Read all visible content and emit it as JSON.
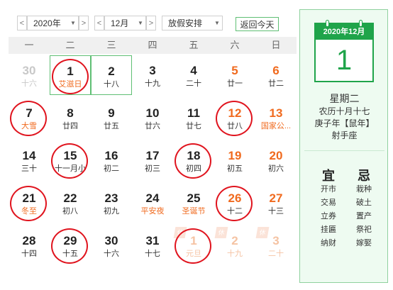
{
  "toolbar": {
    "prev_label": "<",
    "next_label": ">",
    "year_value": "2020年",
    "month_value": "12月",
    "holiday_select": "放假安排",
    "today_button": "返回今天"
  },
  "weekdays": [
    "一",
    "二",
    "三",
    "四",
    "五",
    "六",
    "日"
  ],
  "weeks": [
    [
      {
        "num": "30",
        "sub": "十六",
        "state": "other"
      },
      {
        "num": "1",
        "sub": "艾滋日",
        "state": "fest",
        "today": true,
        "circled": true
      },
      {
        "num": "2",
        "sub": "十八",
        "selected": true
      },
      {
        "num": "3",
        "sub": "十九"
      },
      {
        "num": "4",
        "sub": "二十"
      },
      {
        "num": "5",
        "sub": "廿一",
        "state": "weekend"
      },
      {
        "num": "6",
        "sub": "廿二",
        "state": "weekend"
      }
    ],
    [
      {
        "num": "7",
        "sub": "大雪",
        "state": "fest",
        "circled": true
      },
      {
        "num": "8",
        "sub": "廿四"
      },
      {
        "num": "9",
        "sub": "廿五"
      },
      {
        "num": "10",
        "sub": "廿六"
      },
      {
        "num": "11",
        "sub": "廿七"
      },
      {
        "num": "12",
        "sub": "廿八",
        "state": "weekend",
        "circled": true
      },
      {
        "num": "13",
        "sub": "国家公...",
        "state": "weekend-fest"
      }
    ],
    [
      {
        "num": "14",
        "sub": "三十"
      },
      {
        "num": "15",
        "sub": "十一月小",
        "circled": true
      },
      {
        "num": "16",
        "sub": "初二"
      },
      {
        "num": "17",
        "sub": "初三"
      },
      {
        "num": "18",
        "sub": "初四",
        "circled": true
      },
      {
        "num": "19",
        "sub": "初五",
        "state": "weekend"
      },
      {
        "num": "20",
        "sub": "初六",
        "state": "weekend"
      }
    ],
    [
      {
        "num": "21",
        "sub": "冬至",
        "state": "fest",
        "circled": true
      },
      {
        "num": "22",
        "sub": "初八"
      },
      {
        "num": "23",
        "sub": "初九"
      },
      {
        "num": "24",
        "sub": "平安夜",
        "state": "fest"
      },
      {
        "num": "25",
        "sub": "圣诞节",
        "state": "fest"
      },
      {
        "num": "26",
        "sub": "十二",
        "state": "weekend",
        "circled": true
      },
      {
        "num": "27",
        "sub": "十三",
        "state": "weekend"
      }
    ],
    [
      {
        "num": "28",
        "sub": "十四"
      },
      {
        "num": "29",
        "sub": "十五",
        "circled": true
      },
      {
        "num": "30",
        "sub": "十六"
      },
      {
        "num": "31",
        "sub": "十七"
      },
      {
        "num": "1",
        "sub": "元旦",
        "state": "other-faded",
        "circled": true,
        "tag": "休"
      },
      {
        "num": "2",
        "sub": "十九",
        "state": "other-faded",
        "tag": "休"
      },
      {
        "num": "3",
        "sub": "二十",
        "state": "other-faded",
        "tag": "休"
      }
    ]
  ],
  "side": {
    "header": "2020年12月",
    "day": "1",
    "weekday": "星期二",
    "lunar": "农历十月十七",
    "ganzhi": "庚子年【鼠年】",
    "zodiac": "射手座",
    "yi_label": "宜",
    "ji_label": "忌",
    "yi_items": [
      "开市",
      "交易",
      "立券",
      "挂匾",
      "纳财"
    ],
    "ji_items": [
      "栽种",
      "破土",
      "置产",
      "祭祀",
      "嫁娶"
    ]
  },
  "colors": {
    "accent_green": "#1fa44a",
    "weekend_orange": "#f06a1e",
    "circle_red": "#e0141e"
  }
}
